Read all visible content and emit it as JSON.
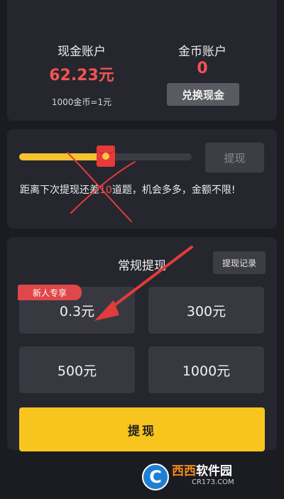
{
  "accounts": {
    "cash_label": "现金账户",
    "cash_value": "62.23元",
    "rate": "1000金币=1元",
    "coin_label": "金币账户",
    "coin_value": "0",
    "exchange_label": "兑换现金"
  },
  "progress": {
    "fill_fraction": 0.5,
    "withdraw_label": "提现",
    "text_prefix": "距离下次提现还差",
    "text_count": "10",
    "text_suffix": "道题，机会多多，金额不限!"
  },
  "withdraw": {
    "title": "常规提现",
    "record_label": "提现记录",
    "new_user_badge": "新人专享",
    "amounts": [
      "0.3元",
      "300元",
      "500元",
      "1000元"
    ],
    "submit_label": "提现"
  },
  "watermark": {
    "logo": "C",
    "name_part1": "西西",
    "name_part2": "软件园",
    "site": "CR173.COM"
  },
  "colors": {
    "accent_red": "#f25353",
    "accent_yellow": "#f7c51e",
    "card_bg": "#25262e",
    "page_bg": "#1b1c22"
  }
}
